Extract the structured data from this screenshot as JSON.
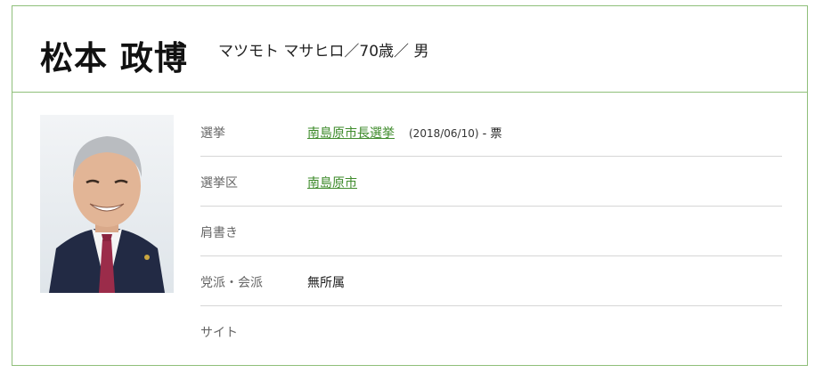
{
  "profile": {
    "name": "松本 政博",
    "subtitle": "マツモト マサヒロ／70歳／ 男"
  },
  "details": {
    "election_label": "選挙",
    "election_link": "南島原市長選挙",
    "election_date": "(2018/06/10)",
    "election_votes": " - 票",
    "district_label": "選挙区",
    "district_link": "南島原市",
    "title_label": "肩書き",
    "party_label": "党派・会派",
    "party_value": "無所属",
    "site_label": "サイト"
  }
}
